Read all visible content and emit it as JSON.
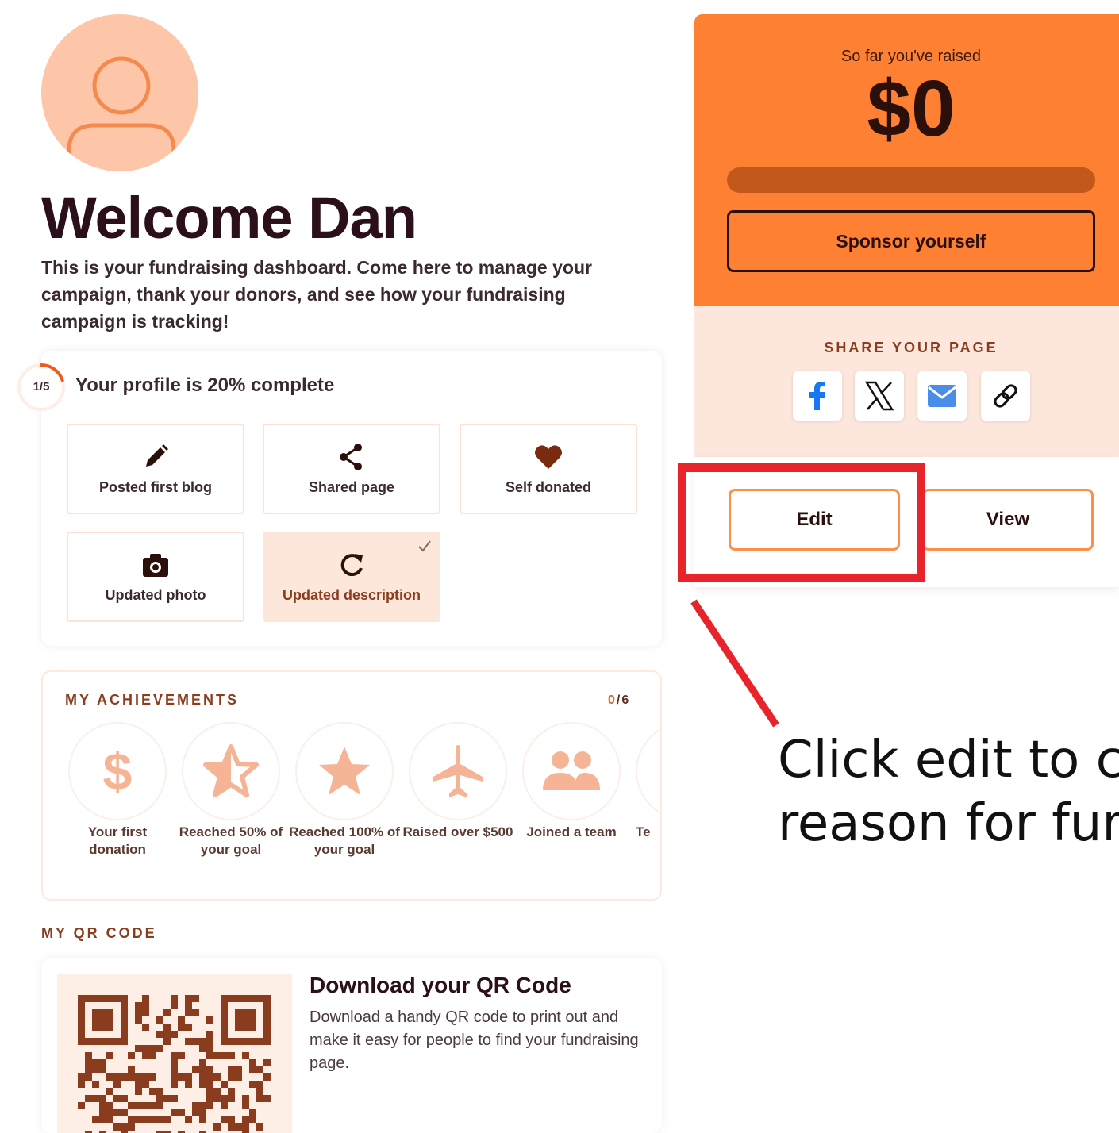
{
  "profile": {
    "welcome": "Welcome Dan",
    "intro": "This is your fundraising dashboard. Come here to manage your campaign, thank your donors, and see how your fundraising campaign is tracking!",
    "progress_label": "1/5",
    "progress_fraction": 0.2,
    "status": "Your profile is 20% complete",
    "tasks": [
      {
        "label": "Posted first blog",
        "icon": "pencil-icon",
        "done": false
      },
      {
        "label": "Shared page",
        "icon": "share-icon",
        "done": false
      },
      {
        "label": "Self donated",
        "icon": "heart-icon",
        "done": false
      },
      {
        "label": "Updated photo",
        "icon": "camera-icon",
        "done": false
      },
      {
        "label": "Updated description",
        "icon": "refresh-icon",
        "done": true
      }
    ]
  },
  "achievements": {
    "title": "MY ACHIEVEMENTS",
    "count_current": "0",
    "count_total": "/6",
    "items": [
      {
        "label": "Your first donation",
        "icon": "dollar-icon"
      },
      {
        "label": "Reached 50% of your goal",
        "icon": "half-star-icon"
      },
      {
        "label": "Reached 100% of your goal",
        "icon": "star-icon"
      },
      {
        "label": "Raised over $500",
        "icon": "airplane-icon"
      },
      {
        "label": "Joined a team",
        "icon": "team-icon"
      },
      {
        "label": "Te",
        "icon": "badge-icon"
      }
    ]
  },
  "qr": {
    "section_title": "MY QR CODE",
    "heading": "Download your QR Code",
    "description": "Download a handy QR code to print out and make it easy for people to find your fundraising page."
  },
  "raised": {
    "label": "So far you've raised",
    "amount": "$0",
    "progress_fraction": 0,
    "sponsor_label": "Sponsor yourself"
  },
  "share": {
    "title": "SHARE YOUR PAGE",
    "buttons": [
      "facebook-icon",
      "x-icon",
      "email-icon",
      "link-icon"
    ]
  },
  "actions": {
    "edit_label": "Edit",
    "view_label": "View"
  },
  "annotation": {
    "hint": "Click edit to c\nreason for fun"
  },
  "colors": {
    "brand_orange": "#fd8033",
    "dark": "#2b0f1a",
    "accent_brown": "#8a3c1e",
    "highlight_red": "#e8232a"
  }
}
